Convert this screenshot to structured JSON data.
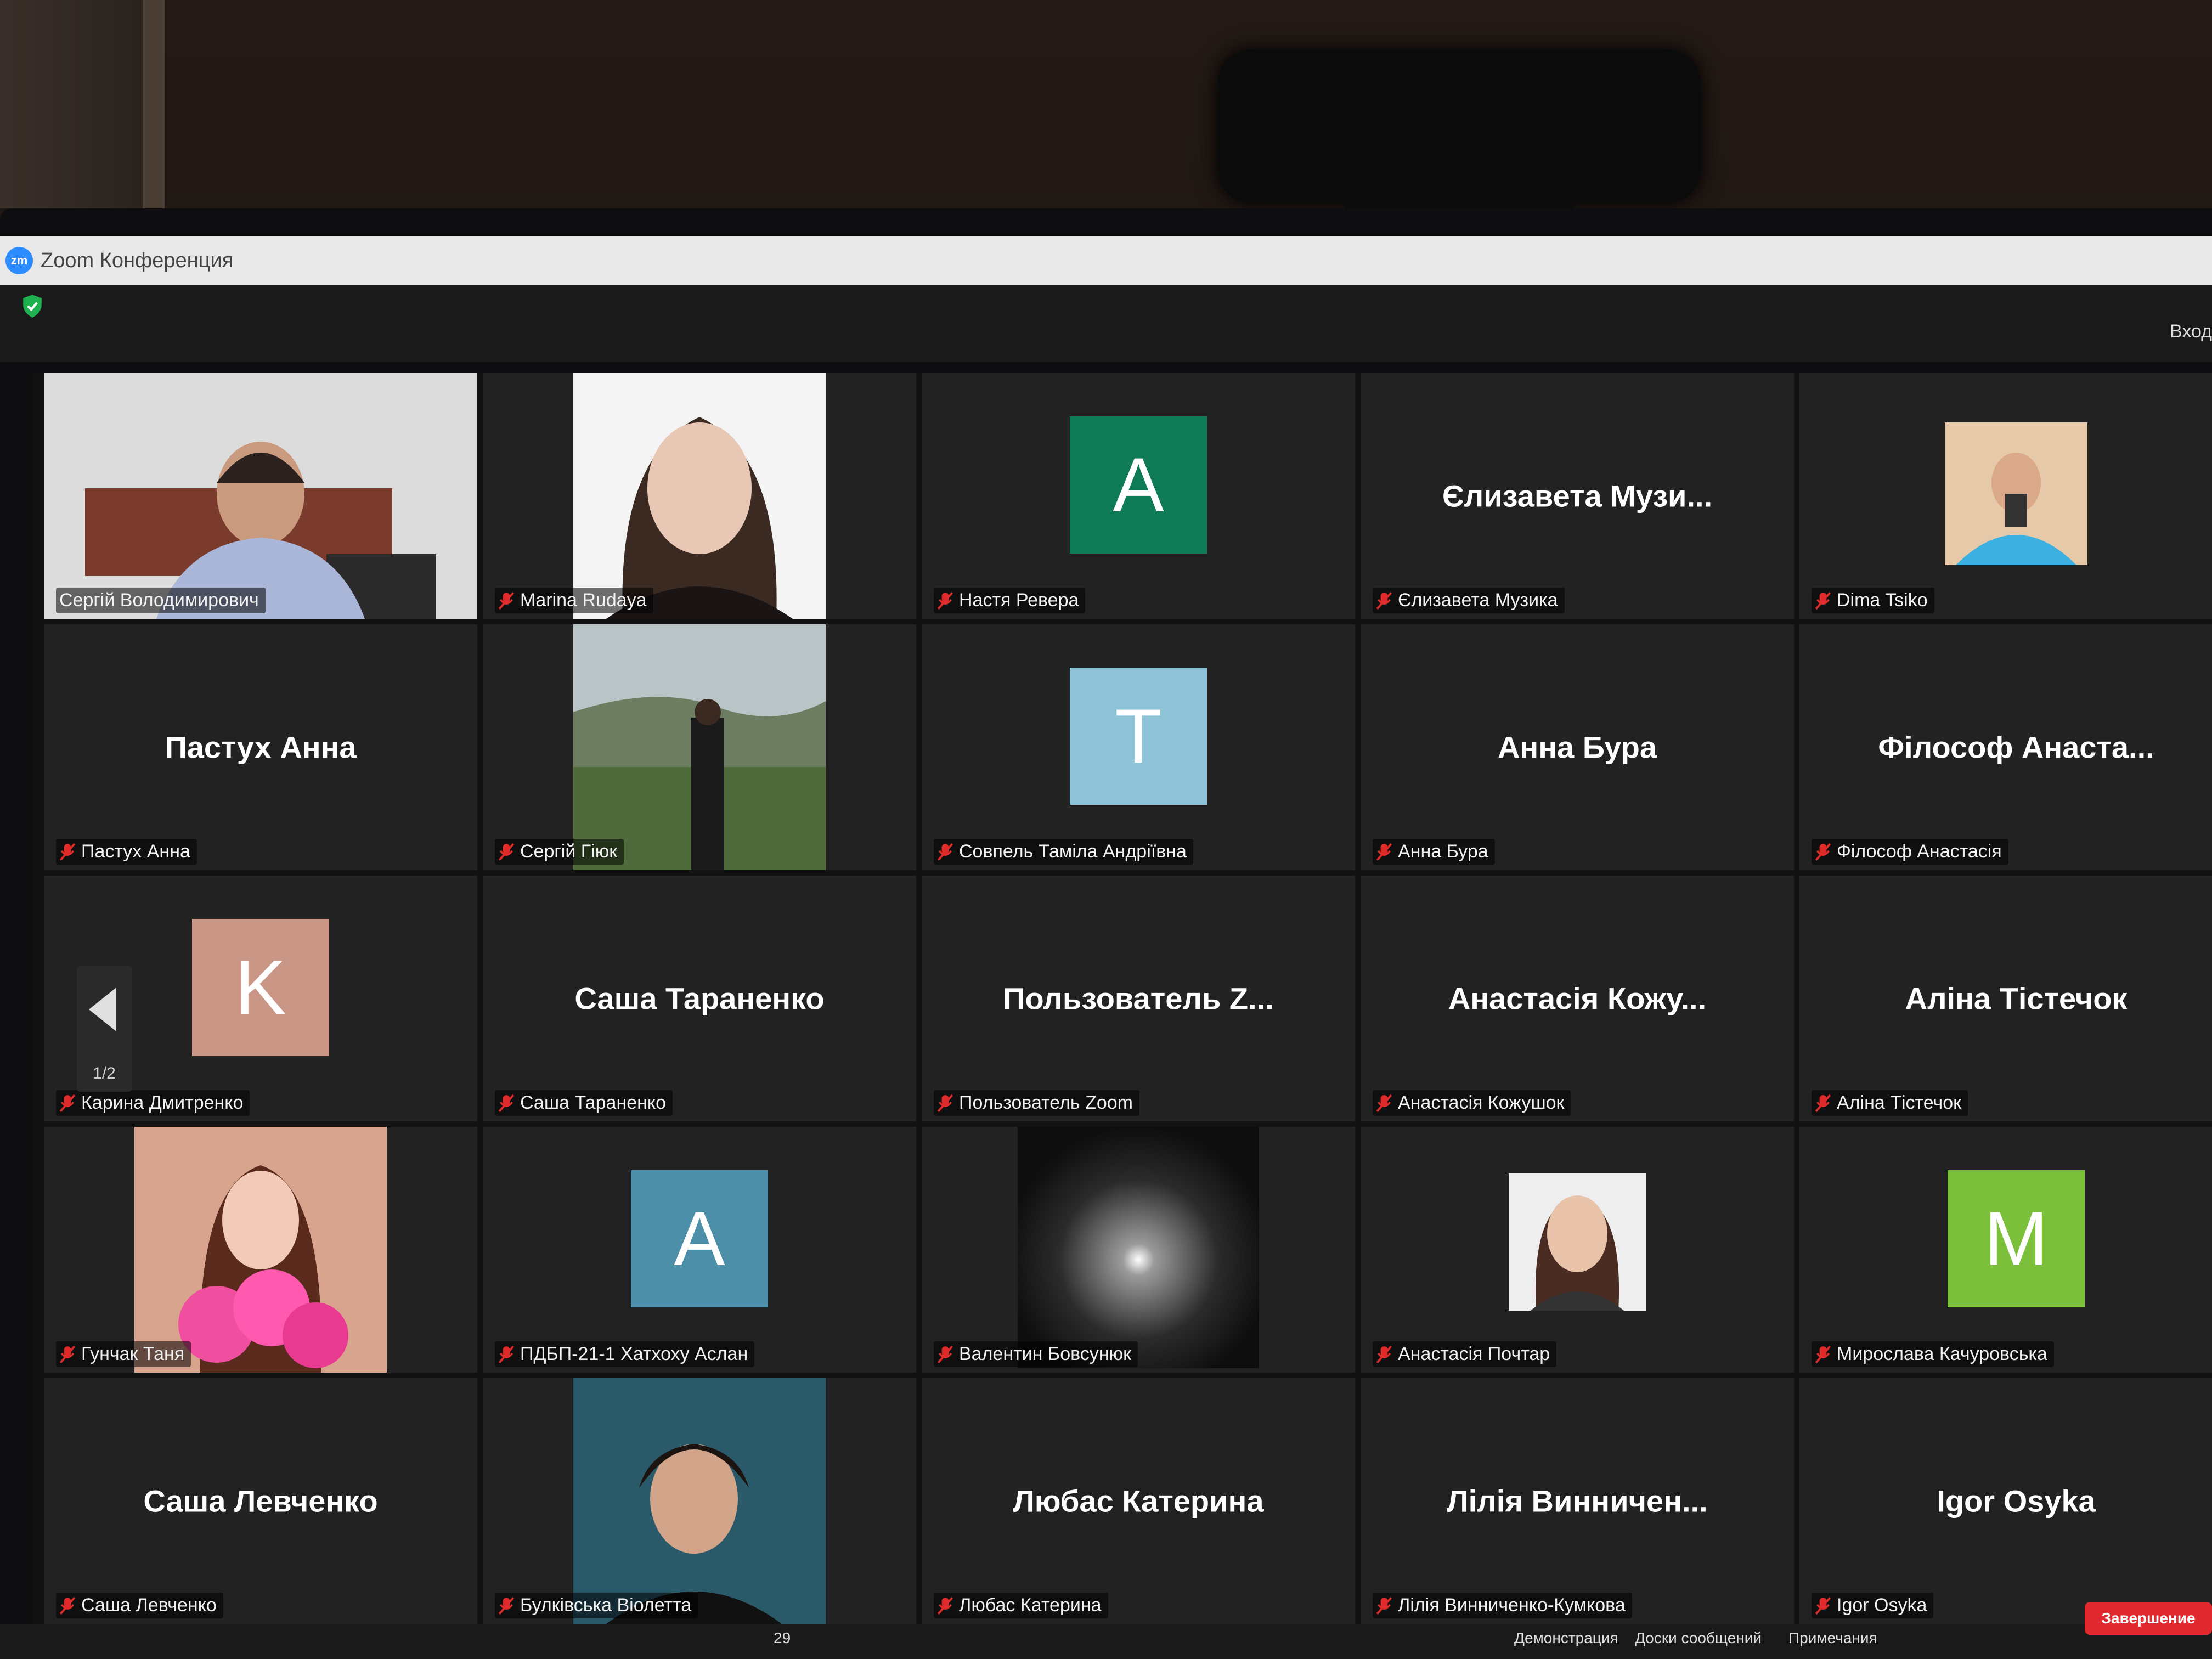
{
  "window": {
    "title": "Zoom Конференция"
  },
  "header": {
    "view_label": "Вход"
  },
  "pagination": {
    "indicator": "1/2"
  },
  "colors": {
    "active_speaker": "#d7e33a",
    "mute": "#e02b2b",
    "end_button": "#e0282e"
  },
  "participants": [
    {
      "label": "Сергій Володимирович",
      "type": "video",
      "photo": "man-headset"
    },
    {
      "label": "Marina Rudaya",
      "type": "video",
      "photo": "woman-portrait"
    },
    {
      "label": "Настя Ревера",
      "type": "avatar",
      "letter": "A",
      "color": "#0f7a56"
    },
    {
      "label": "Єлизавета Музика",
      "type": "name",
      "display": "Єлизавета Музи..."
    },
    {
      "label": "Dima Tsiko",
      "type": "video",
      "photo": "man-selfie"
    },
    {
      "label": "Пастух Анна",
      "type": "name",
      "display": "Пастух Анна"
    },
    {
      "label": "Сергій Гіюк",
      "type": "video",
      "photo": "landscape-person"
    },
    {
      "label": "Совпель Таміла Андріївна",
      "type": "avatar",
      "letter": "T",
      "color": "#8fc3d8"
    },
    {
      "label": "Анна Бура",
      "type": "name",
      "display": "Анна Бура"
    },
    {
      "label": "Філософ Анастасія",
      "type": "name",
      "display": "Філософ Анаста..."
    },
    {
      "label": "Карина Дмитренко",
      "type": "avatar",
      "letter": "K",
      "color": "#c99585"
    },
    {
      "label": "Саша Тараненко",
      "type": "name",
      "display": "Саша Тараненко"
    },
    {
      "label": "Пользователь Zoom",
      "type": "name",
      "display": "Пользователь Z..."
    },
    {
      "label": "Анастасія Кожушок",
      "type": "name",
      "display": "Анастасія Кожу..."
    },
    {
      "label": "Аліна Тістечок",
      "type": "name",
      "display": "Аліна Тістечок"
    },
    {
      "label": "Гунчак Таня",
      "type": "video",
      "photo": "girl-flowers"
    },
    {
      "label": "ПДБП-21-1 Хатхоху Аслан",
      "type": "avatar",
      "letter": "A",
      "color": "#4d8ea8"
    },
    {
      "label": "Валентин Бовсунюк",
      "type": "video",
      "photo": "moon-sky"
    },
    {
      "label": "Анастасія Почтар",
      "type": "video",
      "photo": "woman-selfie"
    },
    {
      "label": "Мирослава Качуровська",
      "type": "avatar",
      "letter": "M",
      "color": "#7cbf3a"
    },
    {
      "label": "Саша Левченко",
      "type": "name",
      "display": "Саша Левченко"
    },
    {
      "label": "Булківська Віолетта",
      "type": "video",
      "photo": "woman-dark"
    },
    {
      "label": "Любас Катерина",
      "type": "name",
      "display": "Любас Катерина"
    },
    {
      "label": "Лілія Винниченко-Кумкова",
      "type": "name",
      "display": "Лілія Винничен..."
    },
    {
      "label": "Igor Osyka",
      "type": "name",
      "display": "Igor Osyka"
    }
  ],
  "toolbar": {
    "participants_count": "29",
    "items": [
      "Демонстрация",
      "Доски сообщений",
      "Примечания"
    ],
    "end_label": "Завершение"
  }
}
